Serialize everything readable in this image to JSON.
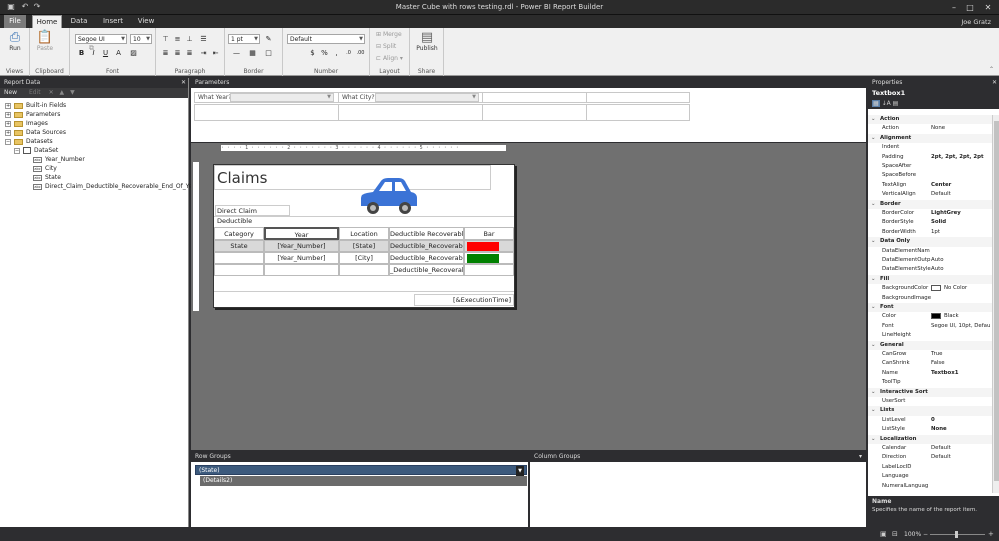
{
  "window": {
    "title": "Master Cube with rows testing.rdl - Power BI Report Builder",
    "user": "Joe Gratz"
  },
  "ribbon_tabs": [
    "File",
    "Home",
    "Data",
    "Insert",
    "View"
  ],
  "ribbon": {
    "run": "Run",
    "views": "Views",
    "paste": "Paste",
    "clipboard": "Clipboard",
    "font_name": "Segoe UI",
    "font_size": "10",
    "font": "Font",
    "paragraph": "Paragraph",
    "border_width": "1 pt",
    "border": "Border",
    "number_format": "Default",
    "number": "Number",
    "merge": "Merge",
    "split": "Split",
    "align": "Align",
    "layout": "Layout",
    "publish": "Publish",
    "share": "Share"
  },
  "report_data": {
    "title": "Report Data",
    "new": "New",
    "edit": "Edit",
    "items": [
      "Built-in Fields",
      "Parameters",
      "Images",
      "Data Sources",
      "Datasets",
      "DataSet",
      "Year_Number",
      "City",
      "State",
      "Direct_Claim_Deductible_Recoverable_End_Of_Year"
    ]
  },
  "parameters": {
    "title": "Parameters",
    "p1": "What Year?",
    "p2": "What City?"
  },
  "report": {
    "title": "Claims",
    "subtitle": "Direct Claim Deductible",
    "headers": [
      "Category",
      "Year",
      "Location",
      "Deductible Recoverable",
      "Bar"
    ],
    "row1": [
      "State",
      "[Year_Number]",
      "[State]",
      "Deductible_Recoverable_"
    ],
    "row2": [
      "",
      "[Year_Number]",
      "[City]",
      "Deductible_Recoverable_"
    ],
    "row3": [
      "",
      "",
      "",
      "_Deductible_Recoverab"
    ],
    "footer": "[&ExecutionTime]",
    "bar_colors": [
      "#ff0000",
      "#008000"
    ]
  },
  "row_groups": {
    "title": "Row Groups",
    "g1": "(State)",
    "g2": "(Details2)"
  },
  "column_groups": {
    "title": "Column Groups"
  },
  "properties": {
    "title": "Properties",
    "selected": "Textbox1",
    "rows": [
      {
        "n": "Action",
        "c": 1
      },
      {
        "n": "Action",
        "v": "None"
      },
      {
        "n": "Alignment",
        "c": 1
      },
      {
        "n": "Indent",
        "v": ""
      },
      {
        "n": "Padding",
        "v": "2pt, 2pt, 2pt, 2pt",
        "b": 1
      },
      {
        "n": "SpaceAfter",
        "v": ""
      },
      {
        "n": "SpaceBefore",
        "v": ""
      },
      {
        "n": "TextAlign",
        "v": "Center",
        "b": 1
      },
      {
        "n": "VerticalAlign",
        "v": "Default"
      },
      {
        "n": "Border",
        "c": 1
      },
      {
        "n": "BorderColor",
        "v": "LightGrey",
        "b": 1
      },
      {
        "n": "BorderStyle",
        "v": "Solid",
        "b": 1
      },
      {
        "n": "BorderWidth",
        "v": "1pt"
      },
      {
        "n": "Data Only",
        "c": 1
      },
      {
        "n": "DataElementNam",
        "v": ""
      },
      {
        "n": "DataElementOutp",
        "v": "Auto"
      },
      {
        "n": "DataElementStyle",
        "v": "Auto"
      },
      {
        "n": "Fill",
        "c": 1
      },
      {
        "n": "BackgroundColor",
        "v": "No Color",
        "sw": "#ffffff"
      },
      {
        "n": "BackgroundImage",
        "v": ""
      },
      {
        "n": "Font",
        "c": 1
      },
      {
        "n": "Color",
        "v": "Black",
        "sw": "#000000"
      },
      {
        "n": "Font",
        "v": "Segoe UI, 10pt, Defau"
      },
      {
        "n": "LineHeight",
        "v": ""
      },
      {
        "n": "General",
        "c": 1
      },
      {
        "n": "CanGrow",
        "v": "True"
      },
      {
        "n": "CanShrink",
        "v": "False"
      },
      {
        "n": "Name",
        "v": "Textbox1",
        "b": 1
      },
      {
        "n": "ToolTip",
        "v": ""
      },
      {
        "n": "Interactive Sort",
        "c": 1
      },
      {
        "n": "UserSort",
        "v": ""
      },
      {
        "n": "Lists",
        "c": 1
      },
      {
        "n": "ListLevel",
        "v": "0",
        "b": 1
      },
      {
        "n": "ListStyle",
        "v": "None",
        "b": 1
      },
      {
        "n": "Localization",
        "c": 1
      },
      {
        "n": "Calendar",
        "v": "Default"
      },
      {
        "n": "Direction",
        "v": "Default"
      },
      {
        "n": "LabelLocID",
        "v": ""
      },
      {
        "n": "Language",
        "v": ""
      },
      {
        "n": "NumeralLanguag",
        "v": ""
      }
    ],
    "desc_title": "Name",
    "desc": "Specifies the name of the report item."
  },
  "status": {
    "zoom": "100%"
  }
}
